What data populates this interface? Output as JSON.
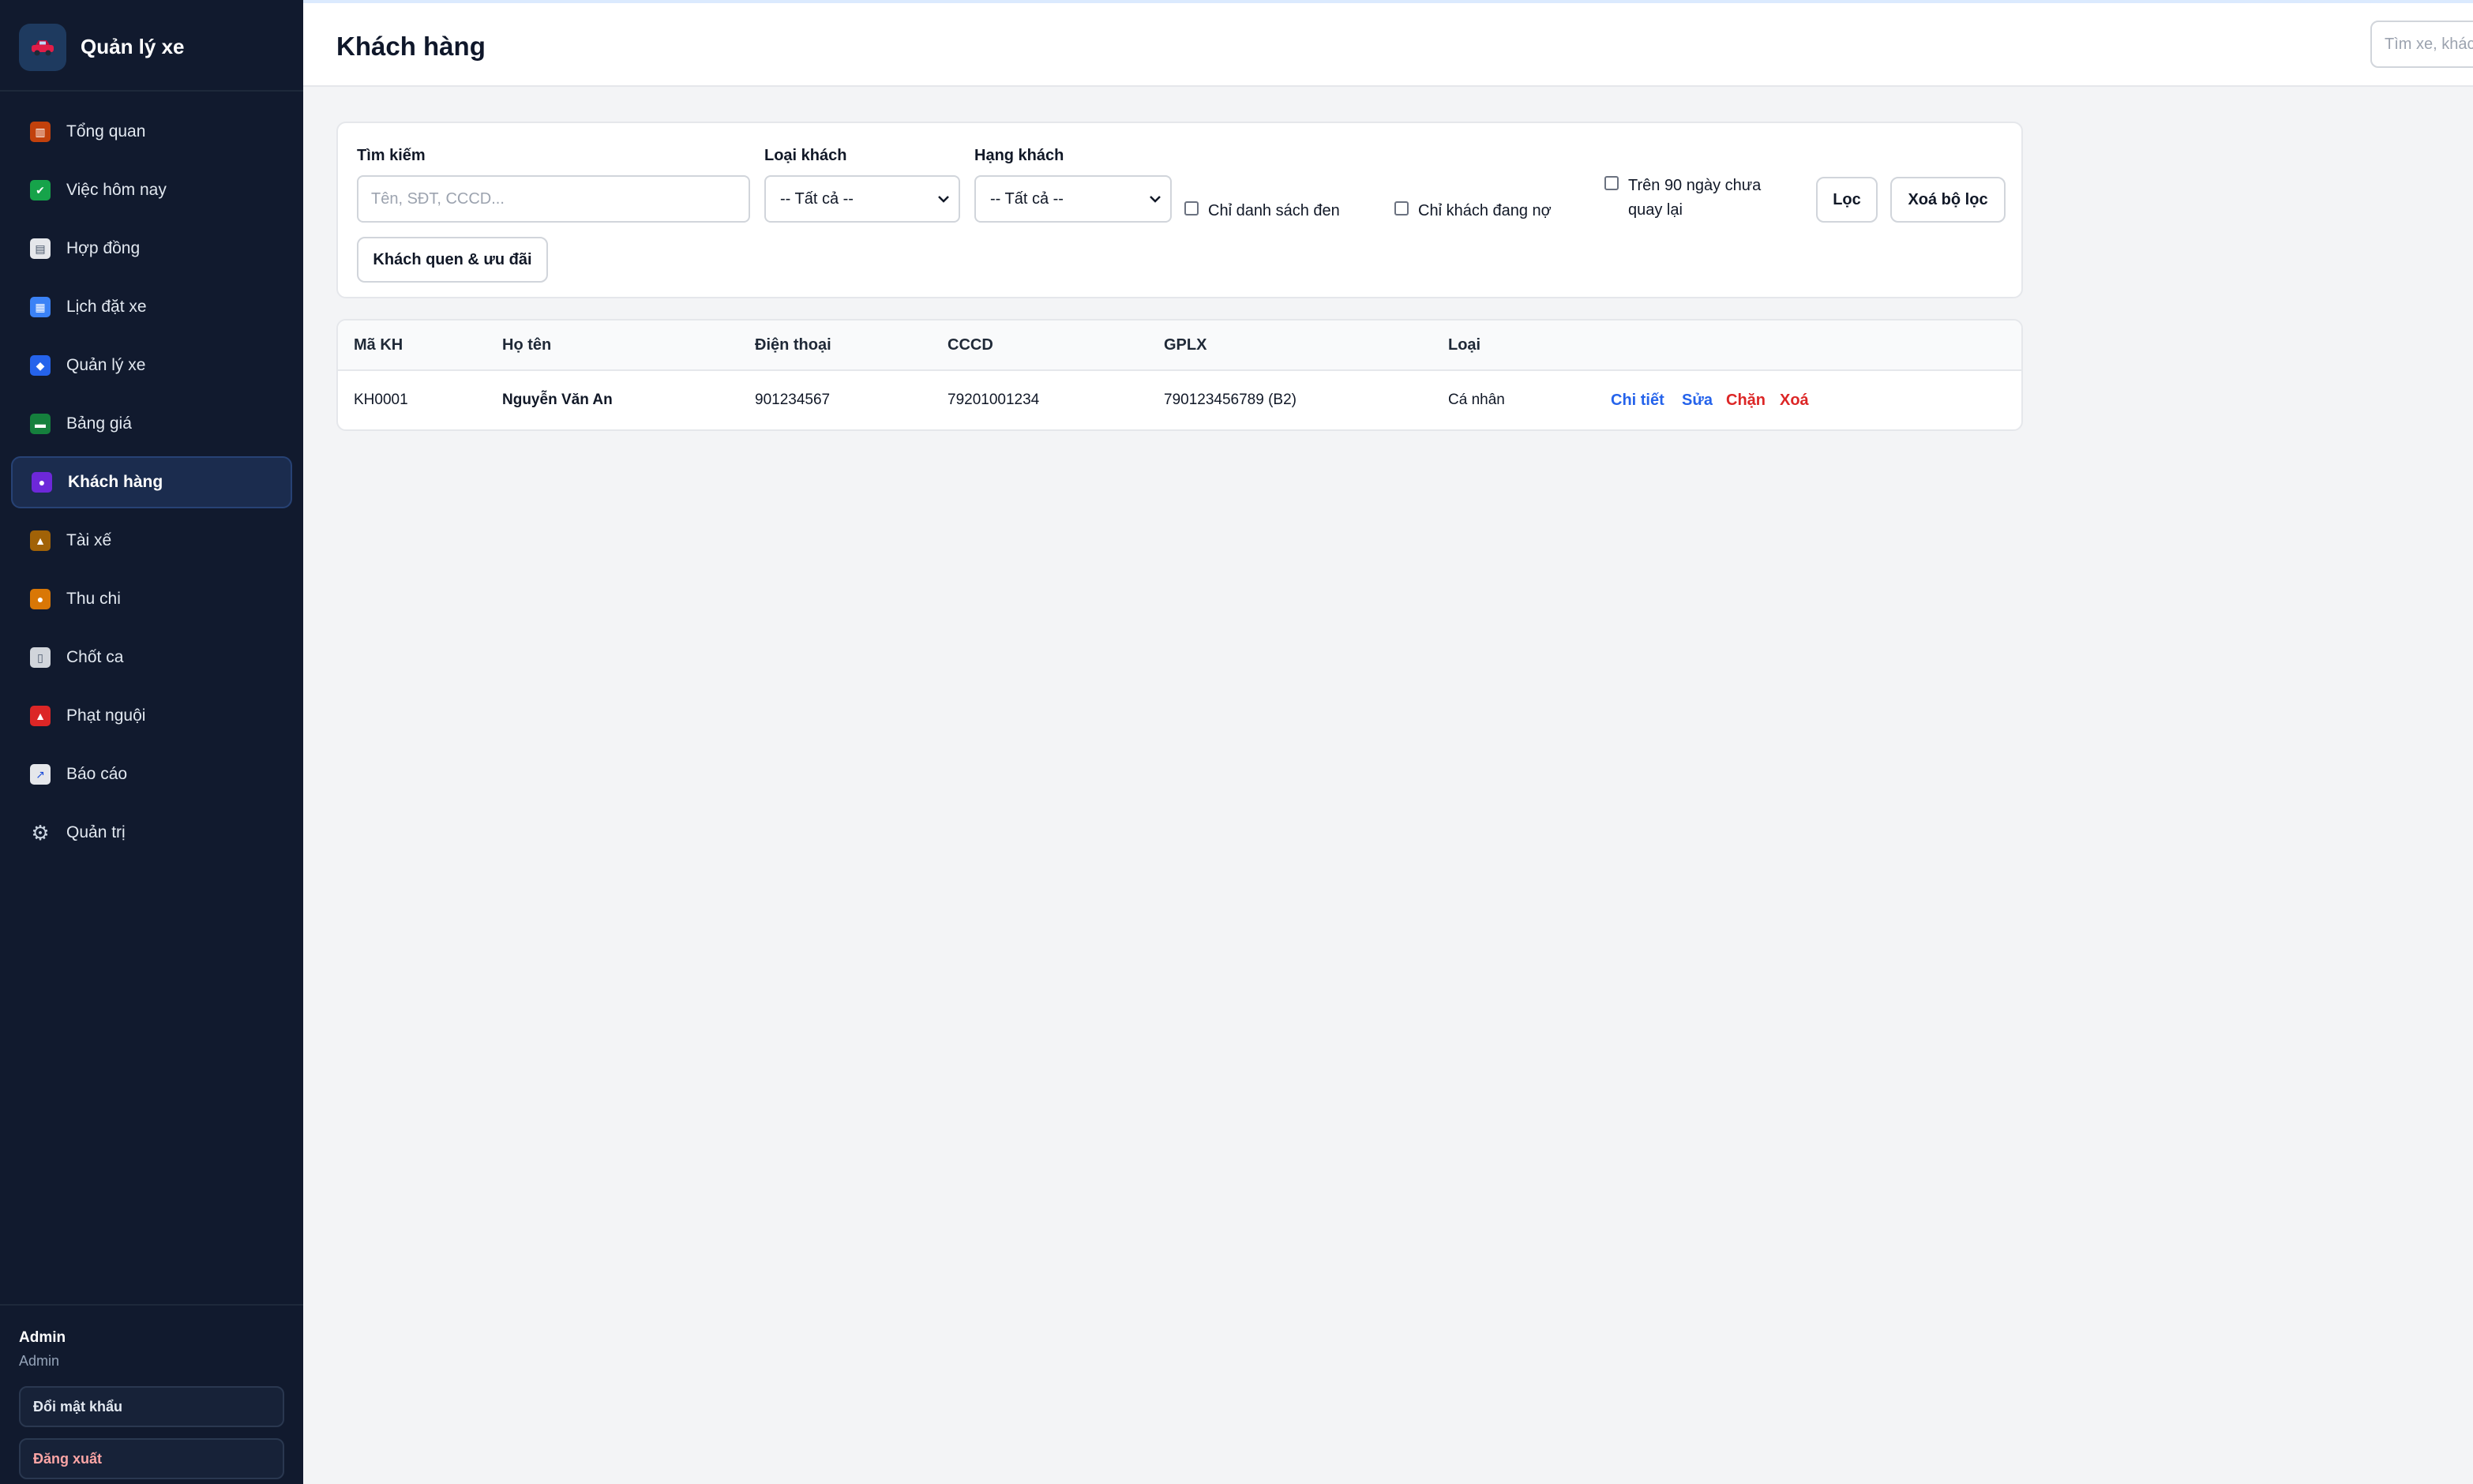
{
  "app": {
    "name": "Quản lý xe",
    "logo_icon": "car-icon"
  },
  "sidebar": {
    "items": [
      {
        "label": "Tổng quan",
        "icon": "chart-icon",
        "color": "#c2410c",
        "glyph": "▥"
      },
      {
        "label": "Việc hôm nay",
        "icon": "check-icon",
        "color": "#16a34a",
        "glyph": "✔"
      },
      {
        "label": "Hợp đồng",
        "icon": "document-icon",
        "color": "#e5e7eb",
        "glyph": "▤"
      },
      {
        "label": "Lịch đặt xe",
        "icon": "calendar-icon",
        "color": "#3b82f6",
        "glyph": "▦"
      },
      {
        "label": "Quản lý xe",
        "icon": "car-icon",
        "color": "#2563eb",
        "glyph": "◆"
      },
      {
        "label": "Bảng giá",
        "icon": "money-icon",
        "color": "#15803d",
        "glyph": "▬"
      },
      {
        "label": "Khách hàng",
        "icon": "users-icon",
        "color": "#6d28d9",
        "glyph": "●"
      },
      {
        "label": "Tài xế",
        "icon": "driver-icon",
        "color": "#a16207",
        "glyph": "▲"
      },
      {
        "label": "Thu chi",
        "icon": "money-bag-icon",
        "color": "#d97706",
        "glyph": "●"
      },
      {
        "label": "Chốt ca",
        "icon": "receipt-icon",
        "color": "#d1d5db",
        "glyph": "▯"
      },
      {
        "label": "Phạt nguội",
        "icon": "siren-icon",
        "color": "#dc2626",
        "glyph": "▲"
      },
      {
        "label": "Báo cáo",
        "icon": "trend-icon",
        "color": "#e5e7eb",
        "glyph": "↗"
      },
      {
        "label": "Quản trị",
        "icon": "gear-icon",
        "color": "#9ca3af",
        "glyph": "⚙"
      }
    ],
    "active_index": 6,
    "user": {
      "name": "Admin",
      "role": "Admin"
    },
    "change_password": "Đổi mật khẩu",
    "logout": "Đăng xuất"
  },
  "header": {
    "title": "Khách hàng",
    "search_placeholder": "Tìm xe, khách..."
  },
  "filters": {
    "search_label": "Tìm kiếm",
    "search_placeholder": "Tên, SĐT, CCCD...",
    "type_label": "Loại khách",
    "type_value": "-- Tất cả --",
    "rank_label": "Hạng khách",
    "rank_value": "-- Tất cả --",
    "blacklist_only": "Chỉ danh sách đen",
    "debt_only": "Chỉ khách đang nợ",
    "inactive_90_line1": "Trên 90 ngày chưa",
    "inactive_90_line2": "quay lại",
    "filter_button": "Lọc",
    "clear_button": "Xoá bộ lọc",
    "loyal_button": "Khách quen & ưu đãi"
  },
  "table": {
    "headers": [
      "Mã KH",
      "Họ tên",
      "Điện thoại",
      "CCCD",
      "GPLX",
      "Loại"
    ],
    "rows": [
      {
        "code": "KH0001",
        "name": "Nguyễn Văn An",
        "phone": "901234567",
        "cccd": "79201001234",
        "gplx": "790123456789 (B2)",
        "type": "Cá nhân"
      }
    ],
    "actions": {
      "detail": "Chi tiết",
      "edit": "Sửa",
      "block": "Chặn",
      "delete": "Xoá"
    }
  }
}
